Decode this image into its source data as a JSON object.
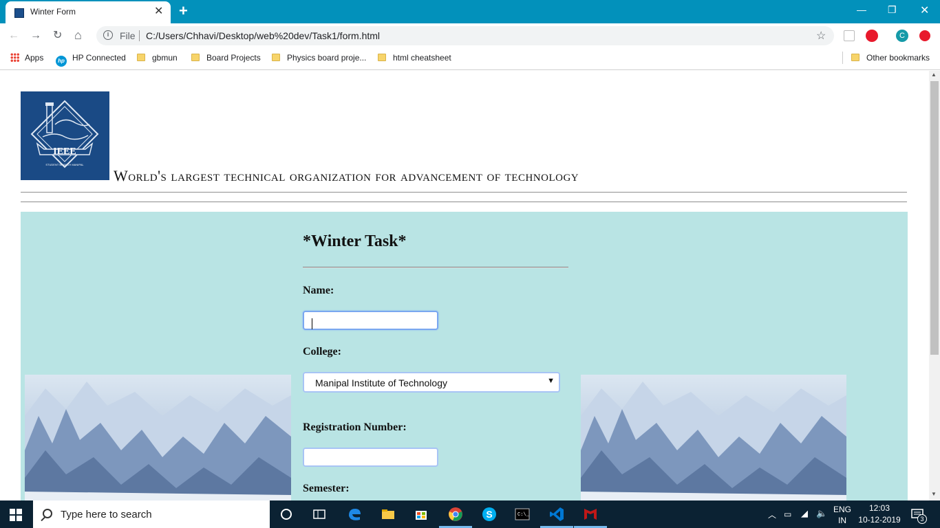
{
  "browser": {
    "tab_title": "Winter Form",
    "tab_close": "✕",
    "new_tab": "+",
    "file_label": "File",
    "url": "C:/Users/Chhavi/Desktop/web%20dev/Task1/form.html",
    "profile_initial": "C"
  },
  "bookmarks": [
    {
      "label": "Apps",
      "icon": "apps-grid-icon"
    },
    {
      "label": "HP Connected",
      "icon": "hp-icon"
    },
    {
      "label": "gbmun",
      "icon": "folder-icon"
    },
    {
      "label": "Board Projects",
      "icon": "folder-icon"
    },
    {
      "label": "Physics board proje...",
      "icon": "folder-icon"
    },
    {
      "label": "html cheatsheet",
      "icon": "folder-icon"
    },
    {
      "label": "Other bookmarks",
      "icon": "folder-icon"
    }
  ],
  "page": {
    "logo_text": "IEEE",
    "logo_subtext": "STUDENT BRANCH MANIPAL",
    "tagline": "World's largest technical organization for advancement of technology",
    "form": {
      "title": "*Winter Task*",
      "name_label": "Name:",
      "name_value": "",
      "college_label": "College:",
      "college_selected": "Manipal Institute of Technology",
      "registration_label": "Registration Number:",
      "registration_value": "",
      "semester_label": "Semester:"
    }
  },
  "taskbar": {
    "search_placeholder": "Type here to search",
    "language_top": "ENG",
    "language_bottom": "IN",
    "time": "12:03",
    "date": "10-12-2019",
    "notification_count": "3"
  },
  "colors": {
    "tabbar": "#0291bb",
    "form_panel": "#b9e4e4",
    "logo_bg": "#1a4a85",
    "taskbar": "#0b2233"
  }
}
